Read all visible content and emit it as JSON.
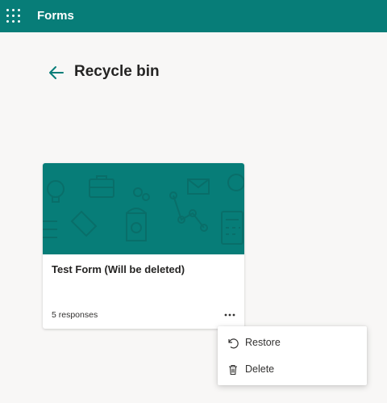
{
  "header": {
    "app_name": "Forms",
    "waffle_icon": "waffle-icon",
    "background_color": "#077d78"
  },
  "page": {
    "title": "Recycle bin",
    "back_icon": "back-arrow-icon"
  },
  "card": {
    "title": "Test Form (Will be deleted)",
    "responses": "5 responses",
    "banner_color": "#077d78",
    "more_icon": "ellipsis-icon"
  },
  "context_menu": {
    "items": [
      {
        "label": "Restore",
        "icon": "undo-icon"
      },
      {
        "label": "Delete",
        "icon": "trash-icon"
      }
    ]
  }
}
